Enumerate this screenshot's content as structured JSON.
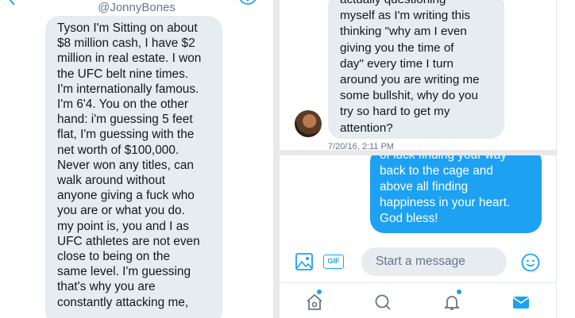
{
  "left_conversation": {
    "handle": "@JonnyBones",
    "message": "Tyson I'm Sitting on about\n$8 million cash, I have $2\nmillion in real estate. I won\nthe UFC belt nine times.\nI'm internationally famous.\nI'm 6'4. You on the other\nhand: i'm guessing 5 feet\nflat, I'm guessing with the\nnet worth of $100,000.\nNever won any titles, can\nwalk around without\nanyone giving a fuck who\nyou are or what you do.\nmy point is, you and I as\nUFC athletes are not even\nclose to being on the\nsame level. I'm guessing\nthat's why you are\nconstantly attacking me,"
  },
  "right_top": {
    "message": "actually questioning\nmyself as I'm writing this\nthinking \"why am I even\ngiving you the time of\nday\" every time I turn\naround you are writing me\nsome bullshit, why do you\ntry so hard to get my\nattention?",
    "timestamp": "7/20/16, 2:11 PM"
  },
  "right_bottom": {
    "message": "of luck finding your way\nback to the cage and\nabove all finding\nhappiness in your heart.\nGod bless!",
    "compose": {
      "gif_label": "GIF",
      "placeholder": "Start a message"
    },
    "tabs": [
      "home-icon",
      "search-icon",
      "notifications-icon",
      "messages-icon"
    ]
  },
  "colors": {
    "accent": "#1da1f2",
    "incoming_bubble": "#e6ecf0",
    "secondary_text": "#657786"
  }
}
